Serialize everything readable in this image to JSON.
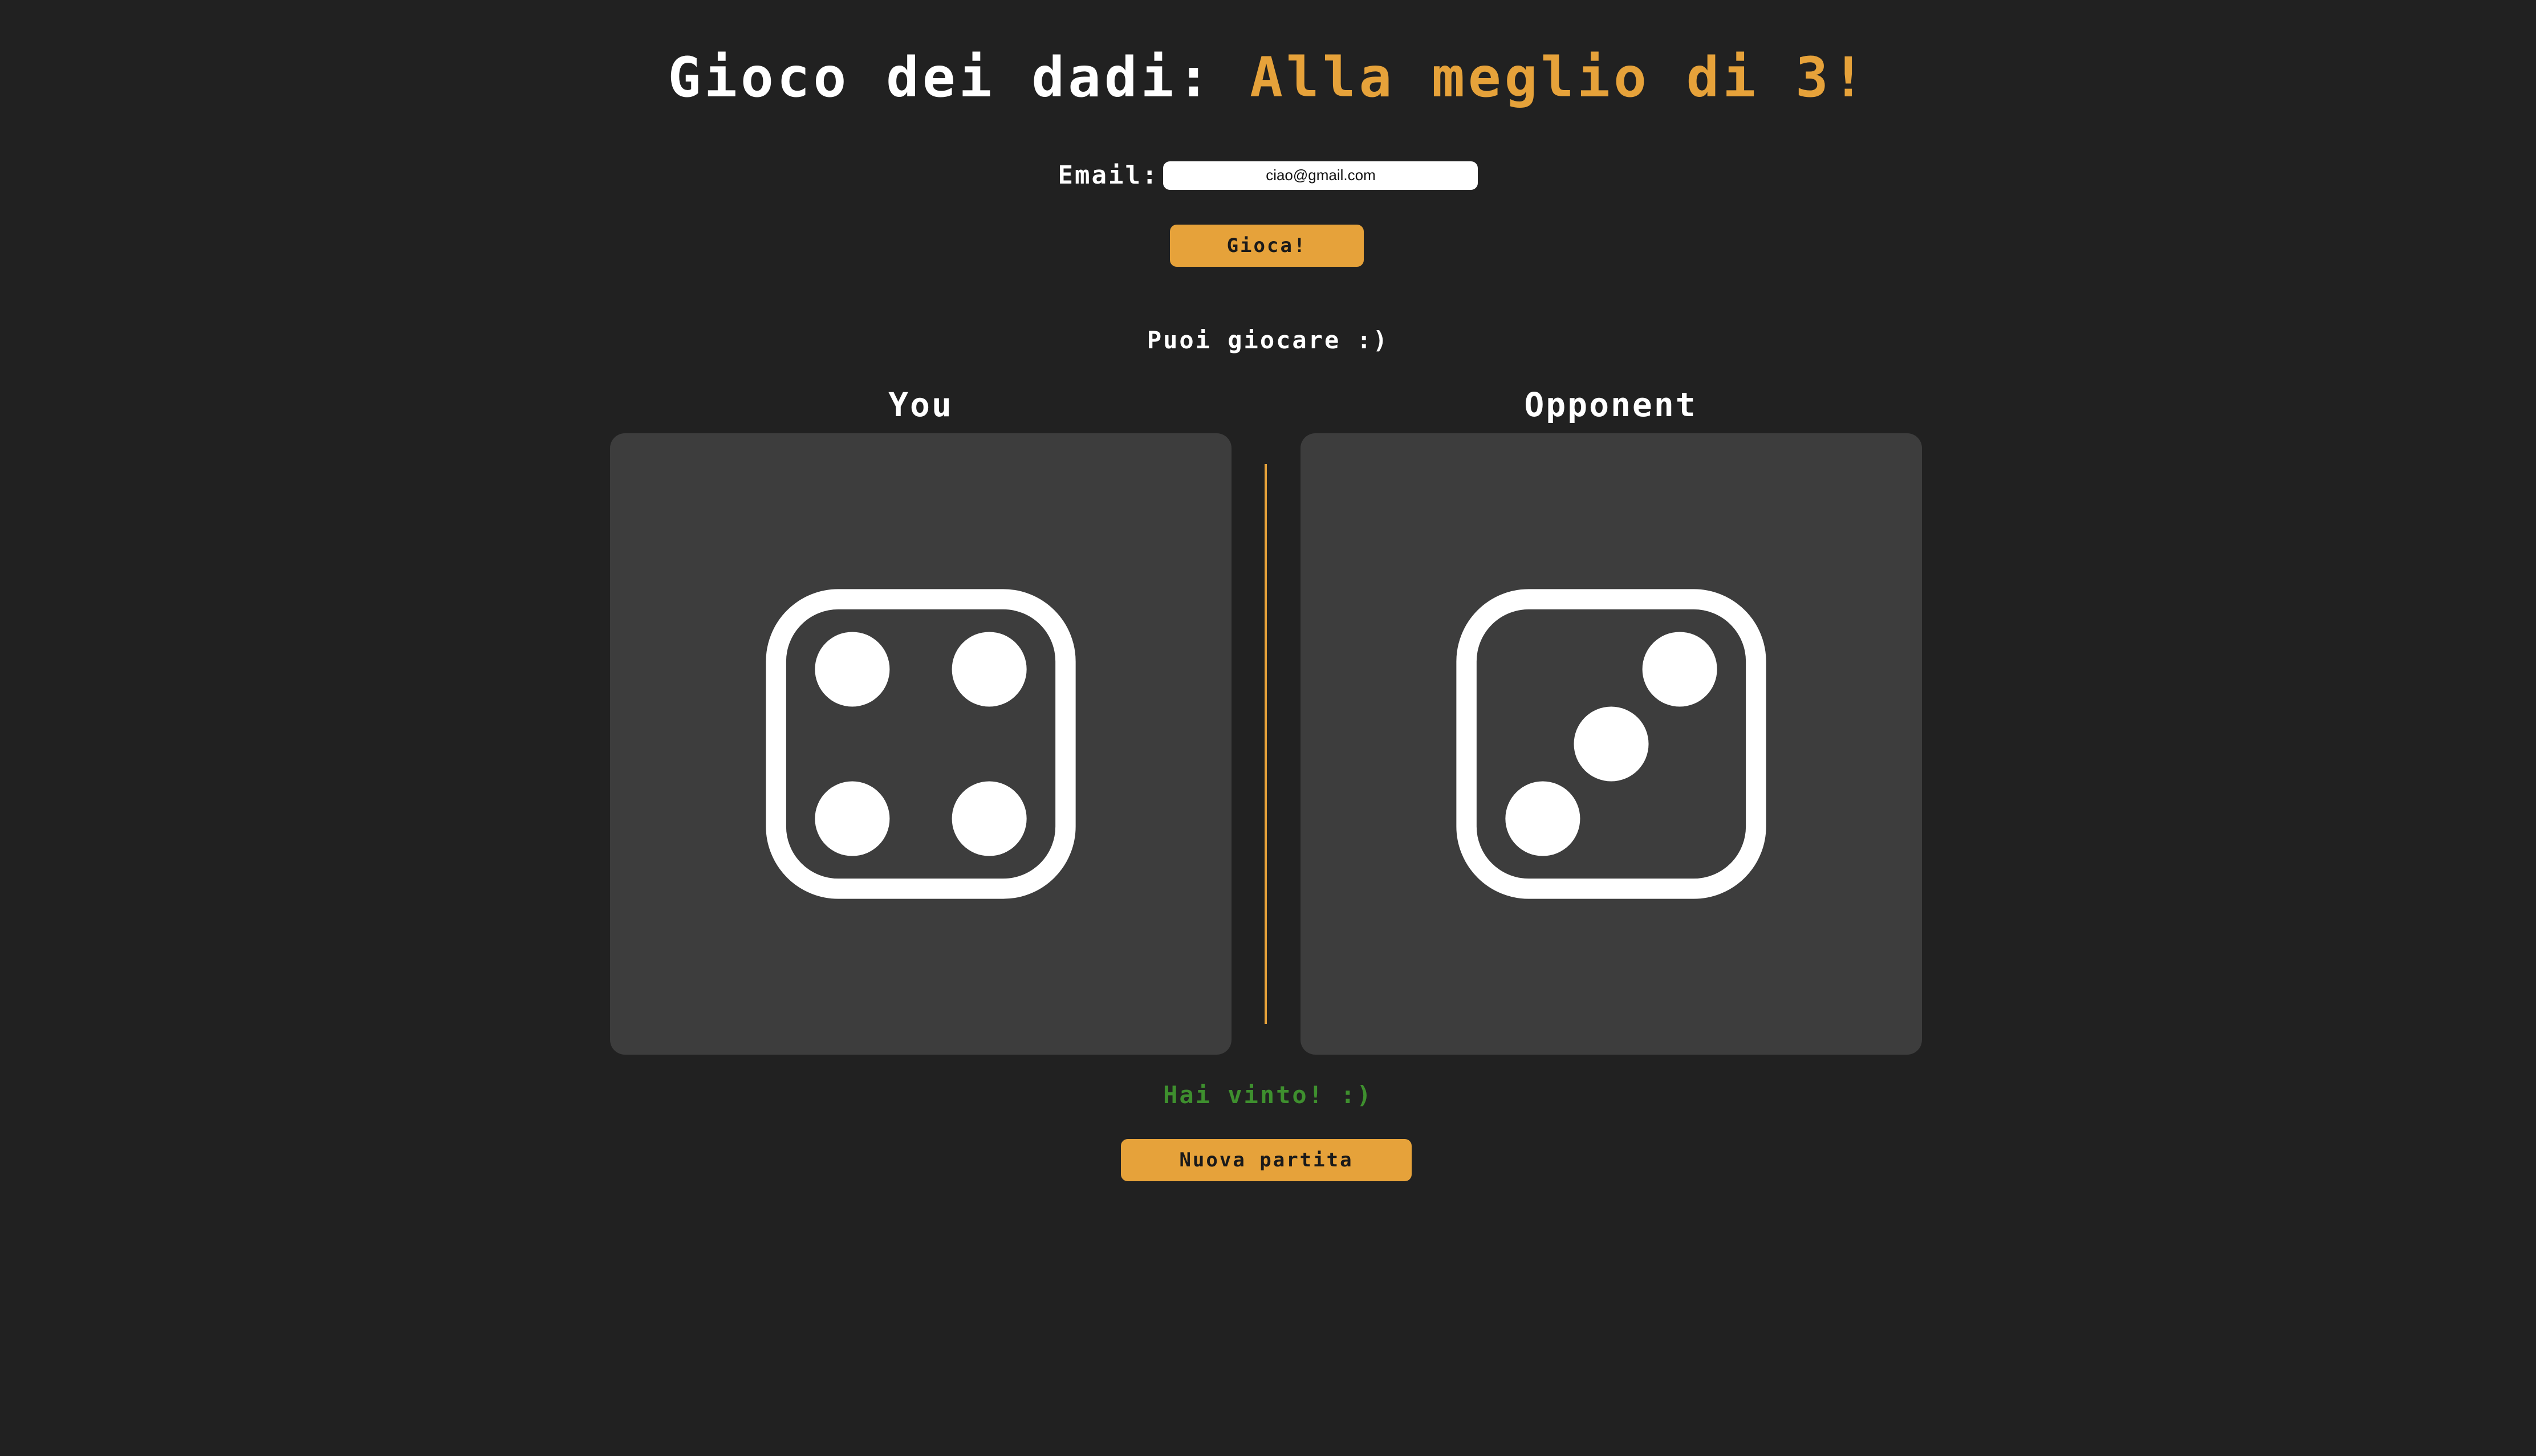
{
  "title": {
    "prefix": "Gioco dei dadi:",
    "accent": "Alla meglio di 3!"
  },
  "email": {
    "label": "Email:",
    "value": "ciao@gmail.com"
  },
  "play_button_label": "Gioca!",
  "status_text": "Puoi giocare :)",
  "players": {
    "you": {
      "label": "You",
      "die_value": 4
    },
    "opponent": {
      "label": "Opponent",
      "die_value": 3
    }
  },
  "result_text": "Hai vinto! :)",
  "new_game_button_label": "Nuova partita",
  "colors": {
    "background": "#212121",
    "panel": "#3d3d3d",
    "accent": "#e6a23a",
    "win": "#3e8f2e"
  },
  "icons": {
    "you_die": "dice-four-icon",
    "opponent_die": "dice-three-icon"
  }
}
